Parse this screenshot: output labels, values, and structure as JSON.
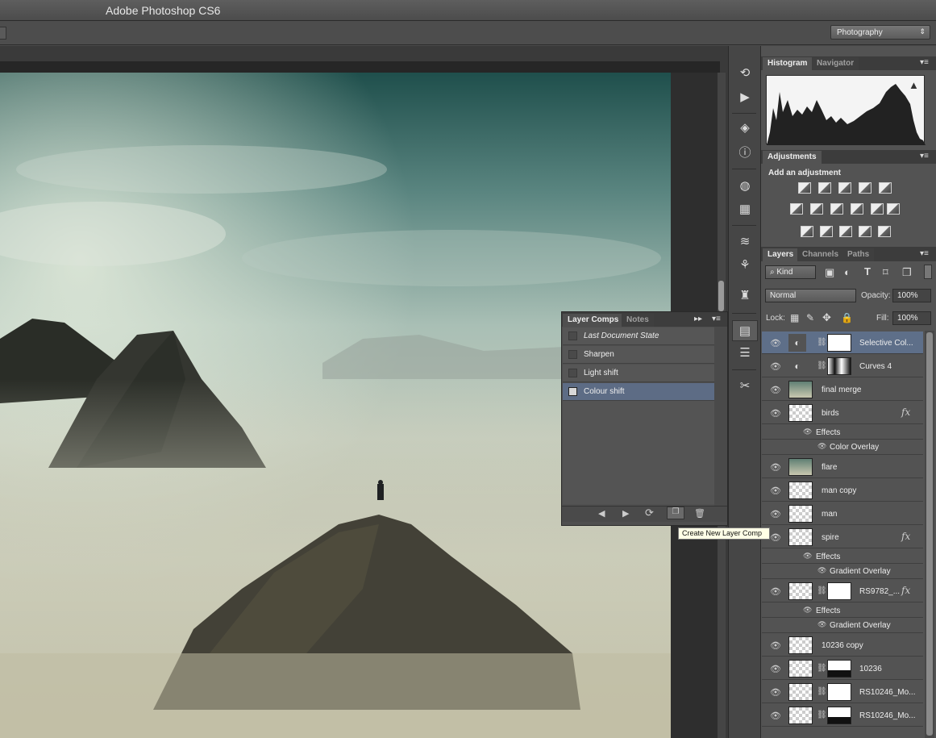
{
  "app": {
    "title": "Adobe Photoshop CS6"
  },
  "options_bar": {
    "workspace": "Photography"
  },
  "panels": {
    "histogram_tab": "Histogram",
    "navigator_tab": "Navigator",
    "adjustments_tab": "Adjustments",
    "adjustments_heading": "Add an adjustment",
    "adjustment_icons": [
      "brightness-contrast-icon",
      "levels-icon",
      "curves-icon",
      "exposure-icon",
      "vibrance-icon",
      "hue-saturation-icon",
      "color-balance-icon",
      "black-white-icon",
      "photo-filter-icon",
      "channel-mixer-icon",
      "color-lookup-icon",
      "invert-icon",
      "posterize-icon",
      "threshold-icon",
      "gradient-map-icon",
      "selective-color-icon"
    ],
    "layers_tab": "Layers",
    "channels_tab": "Channels",
    "paths_tab": "Paths",
    "filter_kind": "Kind",
    "blend_mode": "Normal",
    "opacity_label": "Opacity:",
    "opacity_value": "100%",
    "lock_label": "Lock:",
    "fill_label": "Fill:",
    "fill_value": "100%"
  },
  "layers": [
    {
      "name": "Selective Col...",
      "selected": true
    },
    {
      "name": "Curves 4"
    },
    {
      "name": "final merge"
    },
    {
      "name": "birds",
      "fx": "fx"
    },
    {
      "name": "Effects"
    },
    {
      "name": "Color Overlay"
    },
    {
      "name": "flare"
    },
    {
      "name": "man copy"
    },
    {
      "name": "man"
    },
    {
      "name": "spire",
      "fx": "fx"
    },
    {
      "name": "Effects"
    },
    {
      "name": "Gradient Overlay"
    },
    {
      "name": "RS9782_...",
      "fx": "fx"
    },
    {
      "name": "Effects"
    },
    {
      "name": "Gradient Overlay"
    },
    {
      "name": "10236 copy"
    },
    {
      "name": "10236"
    },
    {
      "name": "RS10246_Mo..."
    },
    {
      "name": "RS10246_Mo..."
    }
  ],
  "layer_comps": {
    "tab_active": "Layer Comps",
    "tab_inactive": "Notes",
    "items": [
      "Last Document State",
      "Sharpen",
      "Light shift",
      "Colour shift"
    ],
    "selected": "Colour shift",
    "tooltip": "Create New Layer Comp"
  },
  "colors": {
    "panel_bg": "#535353",
    "selection": "#5e6f89",
    "tooltip_bg": "#ffffe6"
  }
}
